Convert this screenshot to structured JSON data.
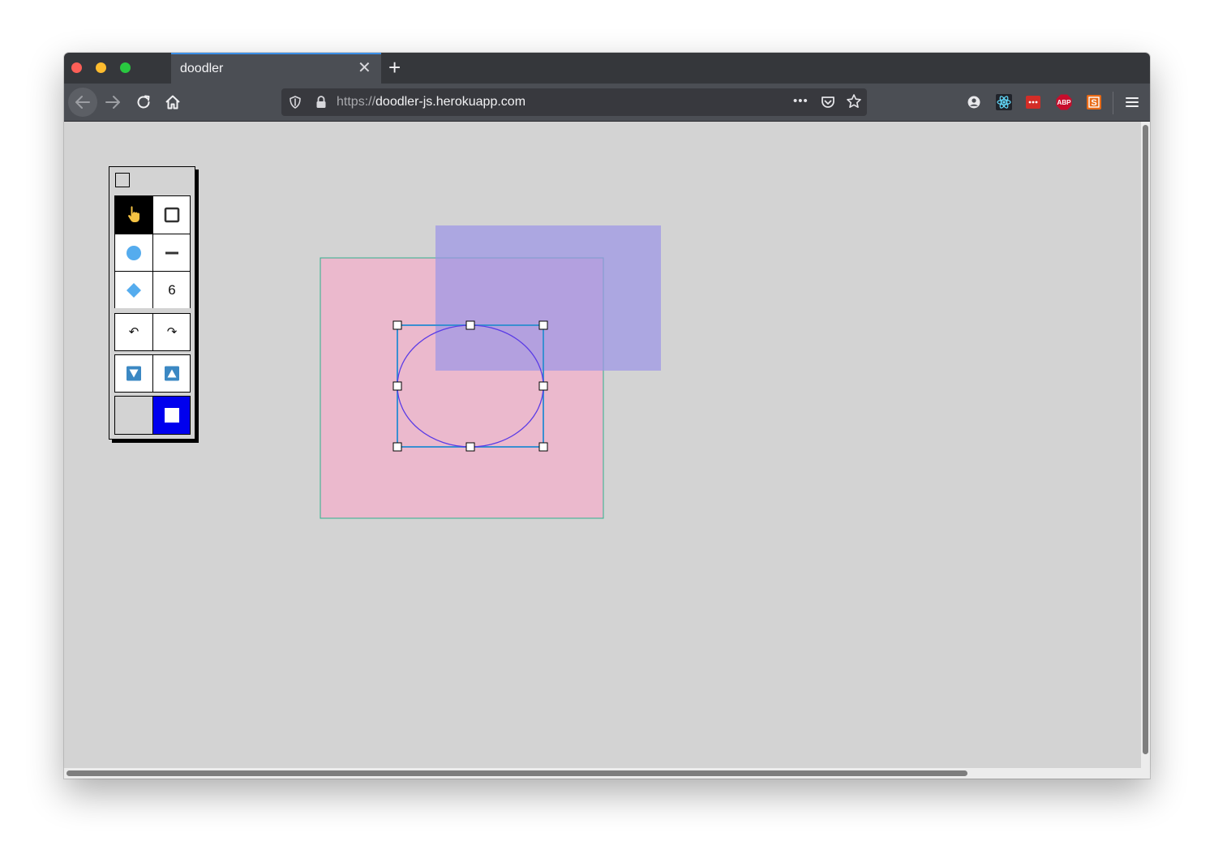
{
  "browser": {
    "tab_title": "doodler",
    "url_scheme": "https://",
    "url_host": "doodler-js.herokuapp.com",
    "page_actions_label": "•••",
    "new_tab_label": "+",
    "tab_close_label": "✕"
  },
  "toolbar": {
    "stroke_width": "6",
    "undo_label": "↶",
    "redo_label": "↷"
  },
  "colors": {
    "fill_swatch": "#d3d3d3",
    "stroke_swatch": "#0000ee",
    "selection": "#3a8fd1",
    "rect_back_fill": "#eeb4cb",
    "rect_back_stroke": "#30b08c",
    "rect_front_fill": "#9d96e6",
    "ellipse_stroke": "#5a3be6"
  }
}
